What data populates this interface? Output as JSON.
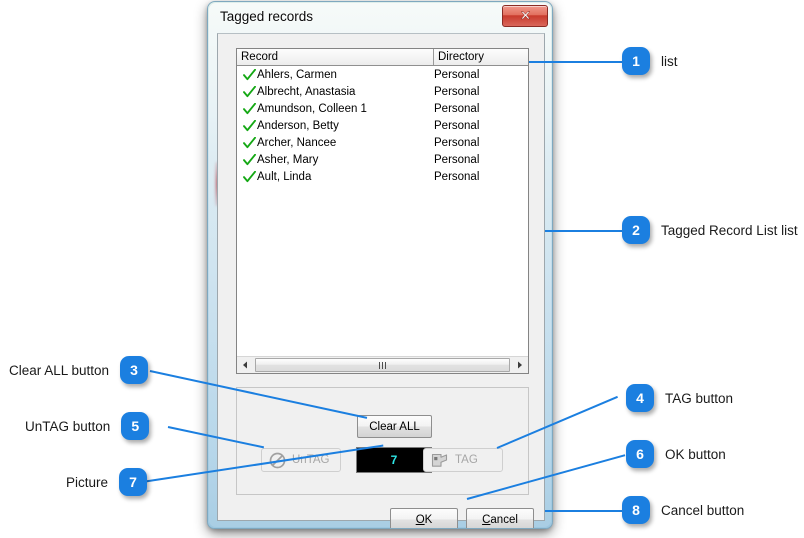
{
  "window": {
    "title": "Tagged records",
    "close_label": "Close",
    "close_icon": "close-x-icon"
  },
  "list": {
    "columns": [
      "Record",
      "Directory"
    ],
    "check_icon": "green-check-icon",
    "rows": [
      {
        "record": "Ahlers, Carmen",
        "directory": "Personal",
        "tagged": true
      },
      {
        "record": "Albrecht, Anastasia",
        "directory": "Personal",
        "tagged": true
      },
      {
        "record": "Amundson, Colleen 1",
        "directory": "Personal",
        "tagged": true
      },
      {
        "record": "Anderson, Betty",
        "directory": "Personal",
        "tagged": true
      },
      {
        "record": "Archer, Nancee",
        "directory": "Personal",
        "tagged": true
      },
      {
        "record": "Asher, Mary",
        "directory": "Personal",
        "tagged": true
      },
      {
        "record": "Ault, Linda",
        "directory": "Personal",
        "tagged": true
      }
    ],
    "hscroll": {
      "left_arrow_icon": "arrow-left-icon",
      "right_arrow_icon": "arrow-right-icon",
      "grip_icon": "grip-dots-icon"
    }
  },
  "actions": {
    "clear_all_label": "Clear ALL",
    "untag_label": "UnTAG",
    "untag_icon": "no-entry-icon",
    "tag_label": "TAG",
    "tag_icon": "tag-flag-icon",
    "counter_value": "7"
  },
  "dialog_buttons": {
    "ok": {
      "prefix": "",
      "accel": "O",
      "suffix": "K"
    },
    "cancel": {
      "prefix": "",
      "accel": "C",
      "suffix": "ancel"
    }
  },
  "annotations": {
    "accent_color": "#1b7fe0",
    "items": [
      {
        "number": "1",
        "label": "list"
      },
      {
        "number": "2",
        "label": "Tagged Record List list"
      },
      {
        "number": "3",
        "label": "Clear ALL button"
      },
      {
        "number": "4",
        "label": "TAG button"
      },
      {
        "number": "5",
        "label": "UnTAG button"
      },
      {
        "number": "6",
        "label": "OK button"
      },
      {
        "number": "7",
        "label": "Picture"
      },
      {
        "number": "8",
        "label": "Cancel button"
      }
    ]
  }
}
